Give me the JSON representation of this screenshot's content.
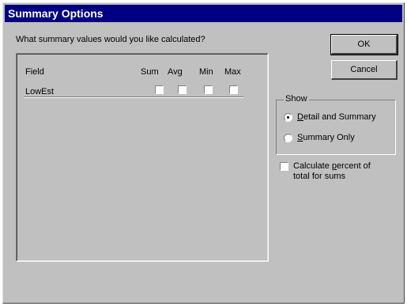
{
  "dialog": {
    "title": "Summary Options",
    "prompt": "What summary values would you like calculated?"
  },
  "table": {
    "headers": {
      "field": "Field",
      "sum": "Sum",
      "avg": "Avg",
      "min": "Min",
      "max": "Max"
    },
    "rows": [
      {
        "field": "LowEst",
        "sum": false,
        "avg": false,
        "min": false,
        "max": false
      }
    ]
  },
  "buttons": {
    "ok": "OK",
    "cancel": "Cancel"
  },
  "show_group": {
    "label": "Show",
    "options": [
      {
        "prefix": "",
        "mnemonic": "D",
        "rest": "etail and Summary",
        "selected": true
      },
      {
        "prefix": "",
        "mnemonic": "S",
        "rest": "ummary Only",
        "selected": false
      }
    ]
  },
  "percent_option": {
    "text_before": "Calculate ",
    "mnemonic": "p",
    "text_after": "ercent of total for sums",
    "checked": false
  }
}
